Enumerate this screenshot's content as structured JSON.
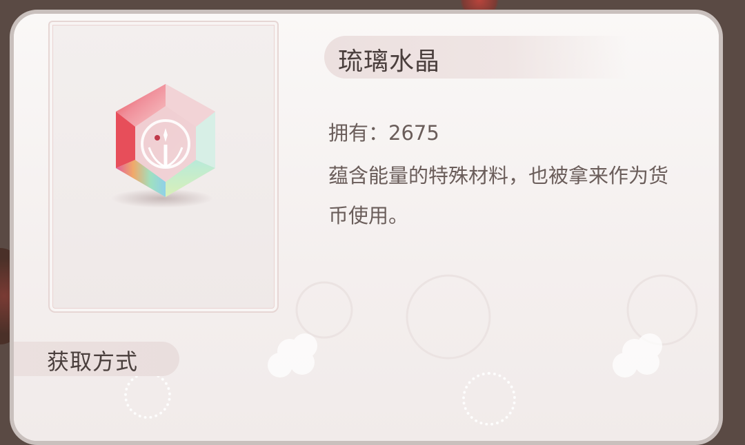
{
  "item": {
    "name": "琉璃水晶",
    "owned_label": "拥有：",
    "owned_count": "2675",
    "description": "蕴含能量的特殊材料，也被拿来作为货币使用。",
    "icon": "rainbow-crystal-icon"
  },
  "sources": {
    "heading": "获取方式"
  },
  "colors": {
    "panel_bg": "#f6f2f1",
    "text_primary": "#4a3f3d",
    "text_secondary": "#6a5d5a",
    "accent_pink": "#e8b7b6"
  }
}
